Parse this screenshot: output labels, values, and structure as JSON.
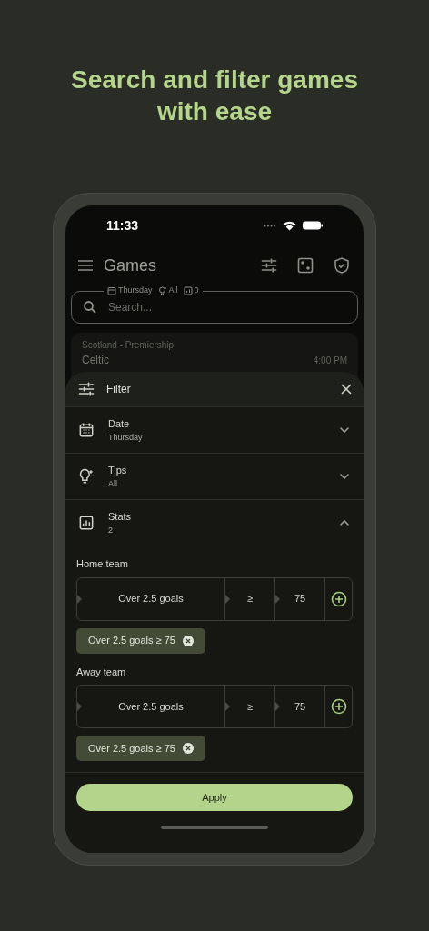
{
  "headline": "Search and filter games with ease",
  "status_bar": {
    "time": "11:33"
  },
  "app_bar": {
    "title": "Games"
  },
  "search": {
    "placeholder": "Search...",
    "summary": [
      {
        "kind": "date",
        "text": "Thursday"
      },
      {
        "kind": "tips",
        "text": "All"
      },
      {
        "kind": "stats",
        "text": "0"
      }
    ]
  },
  "game": {
    "league": "Scotland - Premiership",
    "home": "Celtic",
    "time": "4:00 PM"
  },
  "filter": {
    "title": "Filter",
    "sections": [
      {
        "kind": "date",
        "label": "Date",
        "value": "Thursday",
        "expanded": false
      },
      {
        "kind": "tips",
        "label": "Tips",
        "value": "All",
        "expanded": false
      },
      {
        "kind": "stats",
        "label": "Stats",
        "value": "2",
        "expanded": true
      }
    ],
    "groups": [
      {
        "label": "Home team",
        "stat": "Over 2.5 goals",
        "operator": "≥",
        "threshold": "75",
        "chips": [
          "Over 2.5 goals ≥ 75"
        ]
      },
      {
        "label": "Away team",
        "stat": "Over 2.5 goals",
        "operator": "≥",
        "threshold": "75",
        "chips": [
          "Over 2.5 goals ≥ 75"
        ]
      }
    ],
    "apply": "Apply"
  }
}
